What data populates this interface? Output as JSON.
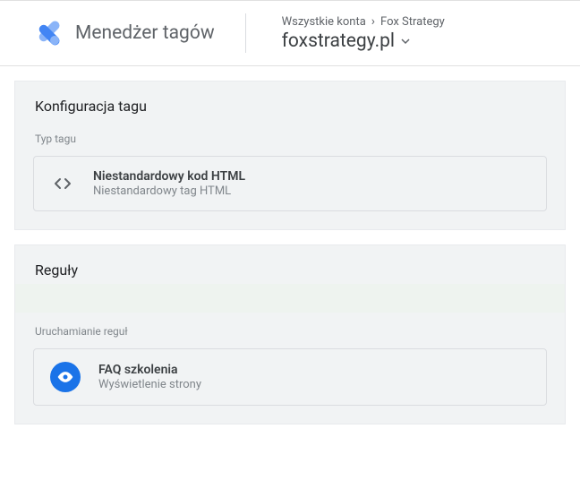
{
  "header": {
    "app_title": "Menedżer tagów",
    "breadcrumb": {
      "level1": "Wszystkie konta",
      "level2": "Fox Strategy"
    },
    "container_name": "foxstrategy.pl"
  },
  "tag_config": {
    "panel_title": "Konfiguracja tagu",
    "type_label": "Typ tagu",
    "tag_type_title": "Niestandardowy kod HTML",
    "tag_type_subtitle": "Niestandardowy tag HTML"
  },
  "triggers": {
    "panel_title": "Reguły",
    "firing_label": "Uruchamianie reguł",
    "trigger_title": "FAQ szkolenia",
    "trigger_subtitle": "Wyświetlenie strony"
  }
}
